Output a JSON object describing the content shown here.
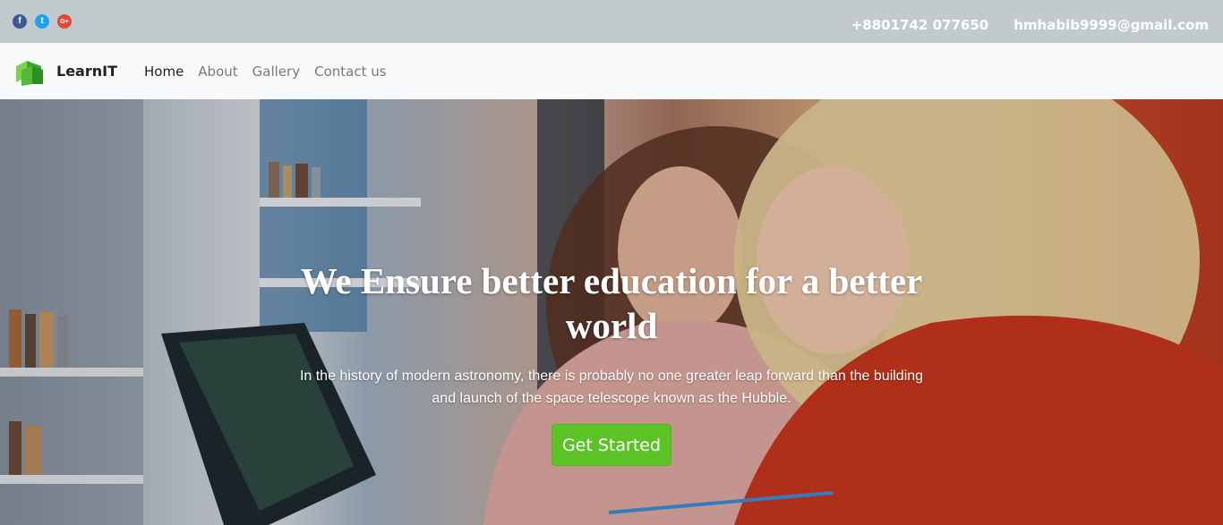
{
  "topbar": {
    "social": [
      {
        "name": "facebook-icon",
        "glyph": "f"
      },
      {
        "name": "twitter-icon",
        "glyph": "t"
      },
      {
        "name": "google-plus-icon",
        "glyph": "G+"
      }
    ],
    "phone": "+8801742 077650",
    "email": "hmhabib9999@gmail.com"
  },
  "navbar": {
    "brand": "LearnIT",
    "items": [
      {
        "label": "Home",
        "active": true
      },
      {
        "label": "About",
        "active": false
      },
      {
        "label": "Gallery",
        "active": false
      },
      {
        "label": "Contact us",
        "active": false
      }
    ]
  },
  "hero": {
    "title": "We Ensure better education for a better world",
    "description": "In the history of modern astronomy, there is probably no one greater leap forward than the building and launch of the space telescope known as the Hubble.",
    "button_label": "Get Started"
  },
  "colors": {
    "topbar_bg": "#c3cacd",
    "navbar_bg": "#f8f9fa",
    "accent_green": "#5bc326"
  }
}
